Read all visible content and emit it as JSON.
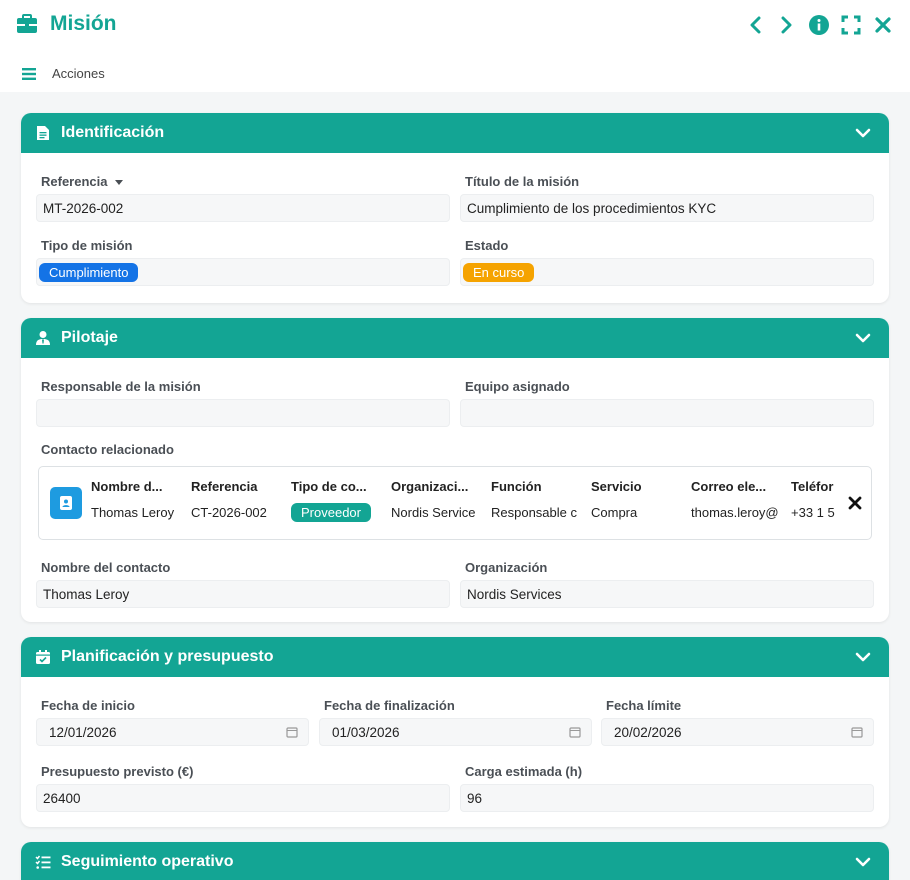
{
  "window": {
    "title": "Misión",
    "actions_label": "Acciones"
  },
  "colors": {
    "accent": "#13a594",
    "blue_tag": "#1473e6",
    "orange_tag": "#f5a300",
    "teal_tag": "#13a594"
  },
  "identificacion": {
    "title": "Identificación",
    "referencia_label": "Referencia",
    "referencia_value": "MT-2026-002",
    "titulo_label": "Título de la misión",
    "titulo_value": "Cumplimiento de los procedimientos KYC",
    "tipo_label": "Tipo de misión",
    "tipo_value": "Cumplimiento",
    "estado_label": "Estado",
    "estado_value": "En curso"
  },
  "pilotaje": {
    "title": "Pilotaje",
    "responsable_label": "Responsable de la misión",
    "responsable_value": "",
    "equipo_label": "Equipo asignado",
    "equipo_value": "",
    "contacto_label": "Contacto relacionado",
    "contact_table": {
      "columns": [
        "Nombre d...",
        "Referencia",
        "Tipo de co...",
        "Organizaci...",
        "Función",
        "Servicio",
        "Correo ele...",
        "Teléfor"
      ],
      "row": [
        "Thomas Leroy",
        "CT-2026-002",
        "Proveedor",
        "Nordis Service",
        "Responsable c",
        "Compra",
        "thomas.leroy@",
        "+33 1 5"
      ]
    },
    "nombre_contacto_label": "Nombre del contacto",
    "nombre_contacto_value": "Thomas Leroy",
    "organizacion_label": "Organización",
    "organizacion_value": "Nordis Services"
  },
  "planificacion": {
    "title": "Planificación y presupuesto",
    "inicio_label": "Fecha de inicio",
    "inicio_value": "12/01/2026",
    "fin_label": "Fecha de finalización",
    "fin_value": "01/03/2026",
    "limite_label": "Fecha límite",
    "limite_value": "20/02/2026",
    "presupuesto_label": "Presupuesto previsto (€)",
    "presupuesto_value": "26400",
    "carga_label": "Carga estimada (h)",
    "carga_value": "96"
  },
  "seguimiento": {
    "title": "Seguimiento operativo"
  }
}
